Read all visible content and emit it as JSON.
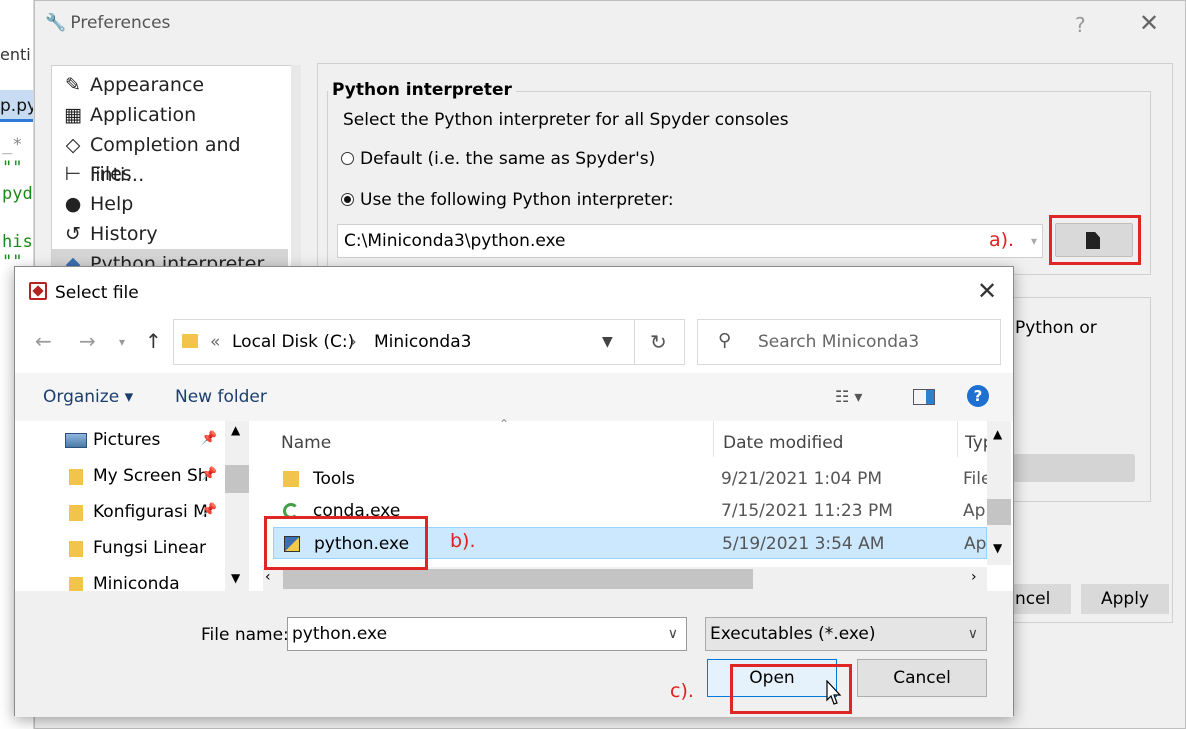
{
  "background_editor": {
    "tab_text": "enti",
    "active_tab_text": "p.py",
    "code_lines": [
      "_*",
      "\"\"",
      "pyd",
      "his",
      "\"\""
    ]
  },
  "preferences": {
    "title": "Preferences",
    "help_glyph": "?",
    "close_glyph": "✕",
    "sidebar": [
      {
        "label": "Appearance",
        "icon": "brush-icon"
      },
      {
        "label": "Application",
        "icon": "layout-icon"
      },
      {
        "label": "Completion and linti…",
        "icon": "code-icon"
      },
      {
        "label": "Files",
        "icon": "tree-icon"
      },
      {
        "label": "Help",
        "icon": "help-icon"
      },
      {
        "label": "History",
        "icon": "history-icon"
      },
      {
        "label": "Python interpreter",
        "icon": "python-icon",
        "selected": true
      }
    ],
    "group_title": "Python interpreter",
    "group_desc": "Select the Python interpreter for all Spyder consoles",
    "radio_default": "Default (i.e. the same as Spyder's)",
    "radio_custom": "Use the following Python interpreter:",
    "interpreter_path": "C:\\Miniconda3\\python.exe",
    "group2_partial_text": "Python or",
    "cancel_partial": "ncel",
    "apply_label": "Apply"
  },
  "dialog": {
    "title": "Select file",
    "close_glyph": "✕",
    "breadcrumb": {
      "root": "Local Disk (C:)",
      "folder": "Miniconda3"
    },
    "search_placeholder": "Search Miniconda3",
    "organize_label": "Organize ▾",
    "new_folder_label": "New folder",
    "nav_items": [
      {
        "label": "Pictures",
        "pinned": true
      },
      {
        "label": "My Screen Sh",
        "pinned": true
      },
      {
        "label": "Konfigurasi M",
        "pinned": true
      },
      {
        "label": "Fungsi Linear",
        "pinned": false
      },
      {
        "label": "Miniconda",
        "pinned": false
      }
    ],
    "columns": {
      "name": "Name",
      "date": "Date modified",
      "type": "Typ"
    },
    "files": [
      {
        "name": "Tools",
        "date": "9/21/2021 1:04 PM",
        "type": "File",
        "icon": "folder-icon"
      },
      {
        "name": "conda.exe",
        "date": "7/15/2021 11:23 PM",
        "type": "Ap",
        "icon": "conda-icon"
      },
      {
        "name": "python.exe",
        "date": "5/19/2021 3:54 AM",
        "type": "Ap",
        "icon": "python-exe-icon",
        "selected": true
      }
    ],
    "file_name_label": "File name:",
    "file_name_value": "python.exe",
    "file_type_value": "Executables (*.exe)",
    "open_label": "Open",
    "cancel_label": "Cancel"
  },
  "annotations": {
    "a": "a).",
    "b": "b).",
    "c": "c)."
  },
  "colors": {
    "highlight_red": "#e02525",
    "selection_blue": "#cce8ff",
    "accent_blue": "#0078d7"
  }
}
